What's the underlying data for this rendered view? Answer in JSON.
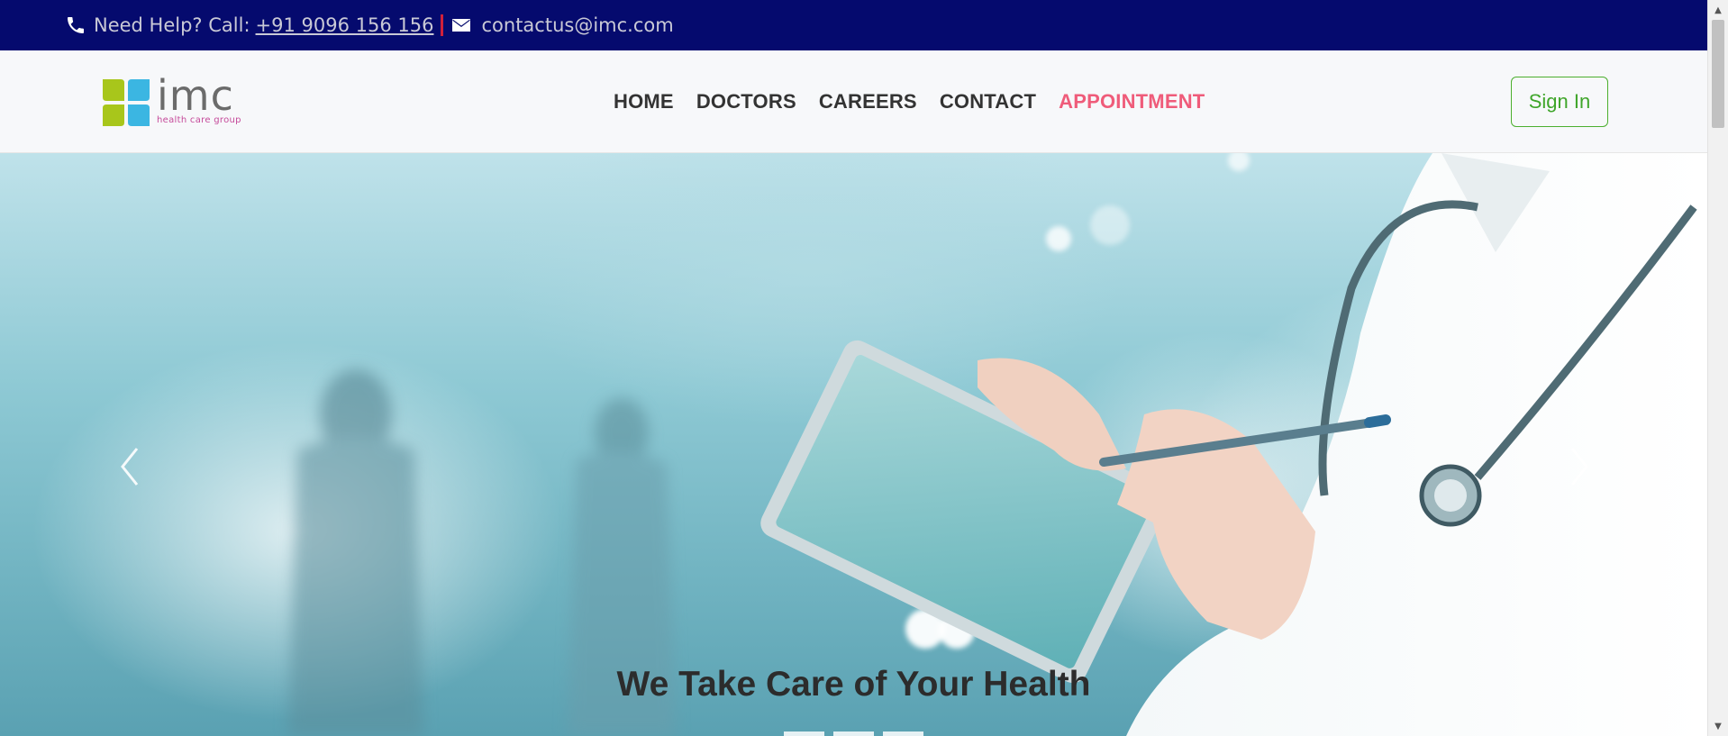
{
  "topbar": {
    "help_text": "Need Help? Call:",
    "phone": "+91 9096 156 156",
    "email": "contactus@imc.com",
    "phone_icon": "phone-icon",
    "mail_icon": "envelope-icon"
  },
  "logo": {
    "word": "imc",
    "subtitle": "health care group",
    "colors": {
      "green": "#a8c61b",
      "blue": "#3bb6e2",
      "text": "#6b6b6b",
      "subtitle": "#c54a9a"
    }
  },
  "nav": {
    "items": [
      {
        "label": "HOME",
        "active": false
      },
      {
        "label": "DOCTORS",
        "active": false
      },
      {
        "label": "CAREERS",
        "active": false
      },
      {
        "label": "CONTACT",
        "active": false
      },
      {
        "label": "APPOINTMENT",
        "active": true
      }
    ],
    "active_color": "#ef5c7a"
  },
  "signin": {
    "label": "Sign In",
    "color": "#4caf2f"
  },
  "hero": {
    "title": "We Take Care of Your Health",
    "prev_icon": "chevron-left-icon",
    "next_icon": "chevron-right-icon",
    "slides": 3
  },
  "colors": {
    "topbar_bg": "#050a6e",
    "navbar_bg": "#f7f8fa"
  }
}
